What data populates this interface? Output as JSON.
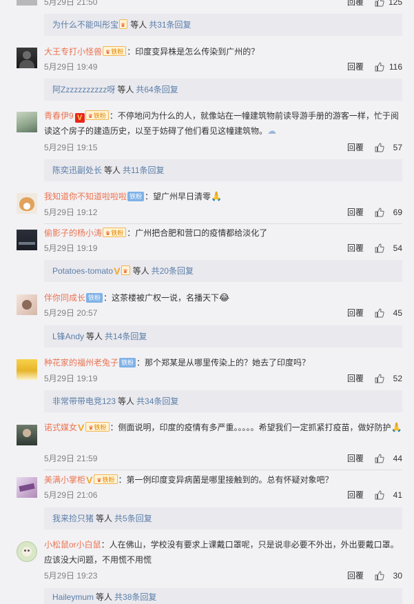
{
  "top": {
    "time": "5月29日 21:50",
    "reply": "回覆",
    "likes": "125",
    "sub_user": "为什么不能叫彤宝",
    "deng": "等人",
    "sub_count": "共31条回复"
  },
  "comments": [
    {
      "user": "大王专打小怪兽",
      "badge": "铁粉",
      "text": "：印度变异株是怎么传染到广州的？",
      "time": "5月29日 19:49",
      "reply": "回覆",
      "likes": "116",
      "sub_user": "阿Zzzzzzzzzzz呀",
      "deng": "等人",
      "sub_count": "共64条回复"
    },
    {
      "user": "青春伊9",
      "badge": "铁粉",
      "text": "：不停地问为什么的人，就像站在一幢建筑物前读导游手册的游客一样，忙于阅读这个房子的建造历史，以至于妨碍了他们看见这幢建筑物。",
      "time": "5月29日 19:15",
      "reply": "回覆",
      "likes": "57",
      "sub_user": "陈奕迅副处长",
      "deng": "等人",
      "sub_count": "共11条回复"
    },
    {
      "user": "我知道你不知道啦啦啦",
      "badge": "铁粉",
      "text": "：望广州早日清零",
      "time": "5月29日 19:12",
      "reply": "回覆",
      "likes": "69"
    },
    {
      "user": "偷影子的杨小涛",
      "badge": "铁粉",
      "text": "：广州把合肥和营口的疫情都给淡化了",
      "time": "5月29日 19:19",
      "reply": "回覆",
      "likes": "54",
      "sub_user": "Potatoes-tomato",
      "deng": "等人",
      "sub_count": "共20条回复"
    },
    {
      "user": "伴你同成长",
      "badge": "铁粉",
      "text": "：这茶楼被广权一说，名播天下",
      "time": "5月29日 20:57",
      "reply": "回覆",
      "likes": "45",
      "sub_user": "L锋Andy",
      "deng": "等人",
      "sub_count": "共14条回复"
    },
    {
      "user": "种花家的福州老兔子",
      "badge": "铁粉",
      "text": "：那个郑某是从哪里传染上的？她去了印度吗？",
      "time": "5月29日 19:19",
      "reply": "回覆",
      "likes": "52",
      "sub_user": "非常带带电竞123",
      "deng": "等人",
      "sub_count": "共34条回复"
    },
    {
      "user": "诺式媒女",
      "badge": "铁粉",
      "text": "：侧面说明，印度的疫情有多严重。。。。。希望我们一定抓紧打疫苗，做好防护",
      "time": "5月29日 21:59",
      "reply": "回覆",
      "likes": "44"
    },
    {
      "user": "美满小掌柜",
      "badge": "铁粉",
      "text": "：第一例印度变异病菌是哪里接触到的。总有怀疑对象吧？",
      "time": "5月29日 21:06",
      "reply": "回覆",
      "likes": "41",
      "sub_user": "我来捡只猪",
      "deng": "等人",
      "sub_count": "共5条回复"
    },
    {
      "user": "小松鼠or小白鼠",
      "text": "：人在佛山，学校没有要求上课戴口罩呢，只是说非必要不外出，外出要戴口罩。应该没大问题，不用慌不用慌",
      "time": "5月29日 19:23",
      "reply": "回覆",
      "likes": "30",
      "sub_user": "Haileymum",
      "deng": "等人",
      "sub_count": "共38条回复"
    }
  ],
  "colors": {
    "background": "#f2f2f5",
    "username": "#eb7350",
    "link": "#5b7ea8",
    "sub_panel": "#e9e9ee",
    "meta": "#808080"
  }
}
